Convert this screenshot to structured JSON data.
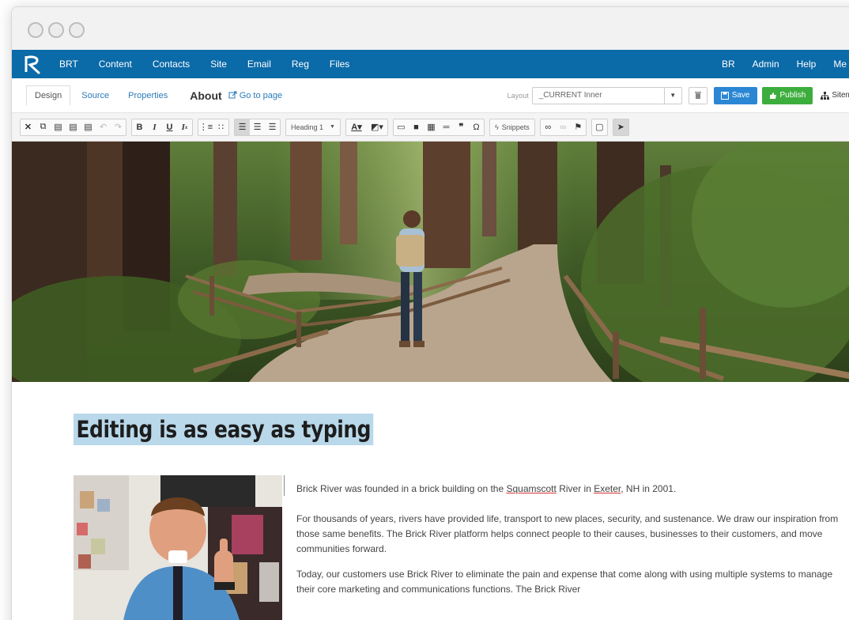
{
  "nav": {
    "left": [
      "BRT",
      "Content",
      "Contacts",
      "Site",
      "Email",
      "Reg",
      "Files"
    ],
    "right": [
      "BR",
      "Admin",
      "Help",
      "Me"
    ]
  },
  "editor": {
    "tabs": [
      "Design",
      "Source",
      "Properties"
    ],
    "page_name": "About",
    "goto_label": "Go to page",
    "layout_label": "Layout",
    "layout_value": "_CURRENT Inner",
    "save_label": "Save",
    "publish_label": "Publish",
    "sitemap_label": "Sitemap"
  },
  "toolbar": {
    "heading_dropdown": "Heading 1",
    "snippets_label": "Snippets"
  },
  "content": {
    "heading": "Editing is as easy as typing",
    "p1_pre": "Brick River was founded in a brick building on the ",
    "p1_link1": "Squamscott",
    "p1_mid": " River in ",
    "p1_link2": "Exeter",
    "p1_post": ", NH in 2001.",
    "p2": "For thousands of years, rivers have provided life, transport to new places, security, and sustenance. We draw our inspiration from those same benefits. The Brick River platform helps connect people to their causes, businesses to their customers, and move communities forward.",
    "p3": "Today, our customers use Brick River to eliminate the pain and expense that come along with using multiple systems to manage their core marketing and communications functions. The Brick River"
  },
  "colors": {
    "nav_bg": "#0b6aa8",
    "save_bg": "#2b86d4",
    "publish_bg": "#3dae3d",
    "heading_highlight": "#b9d8ea"
  }
}
